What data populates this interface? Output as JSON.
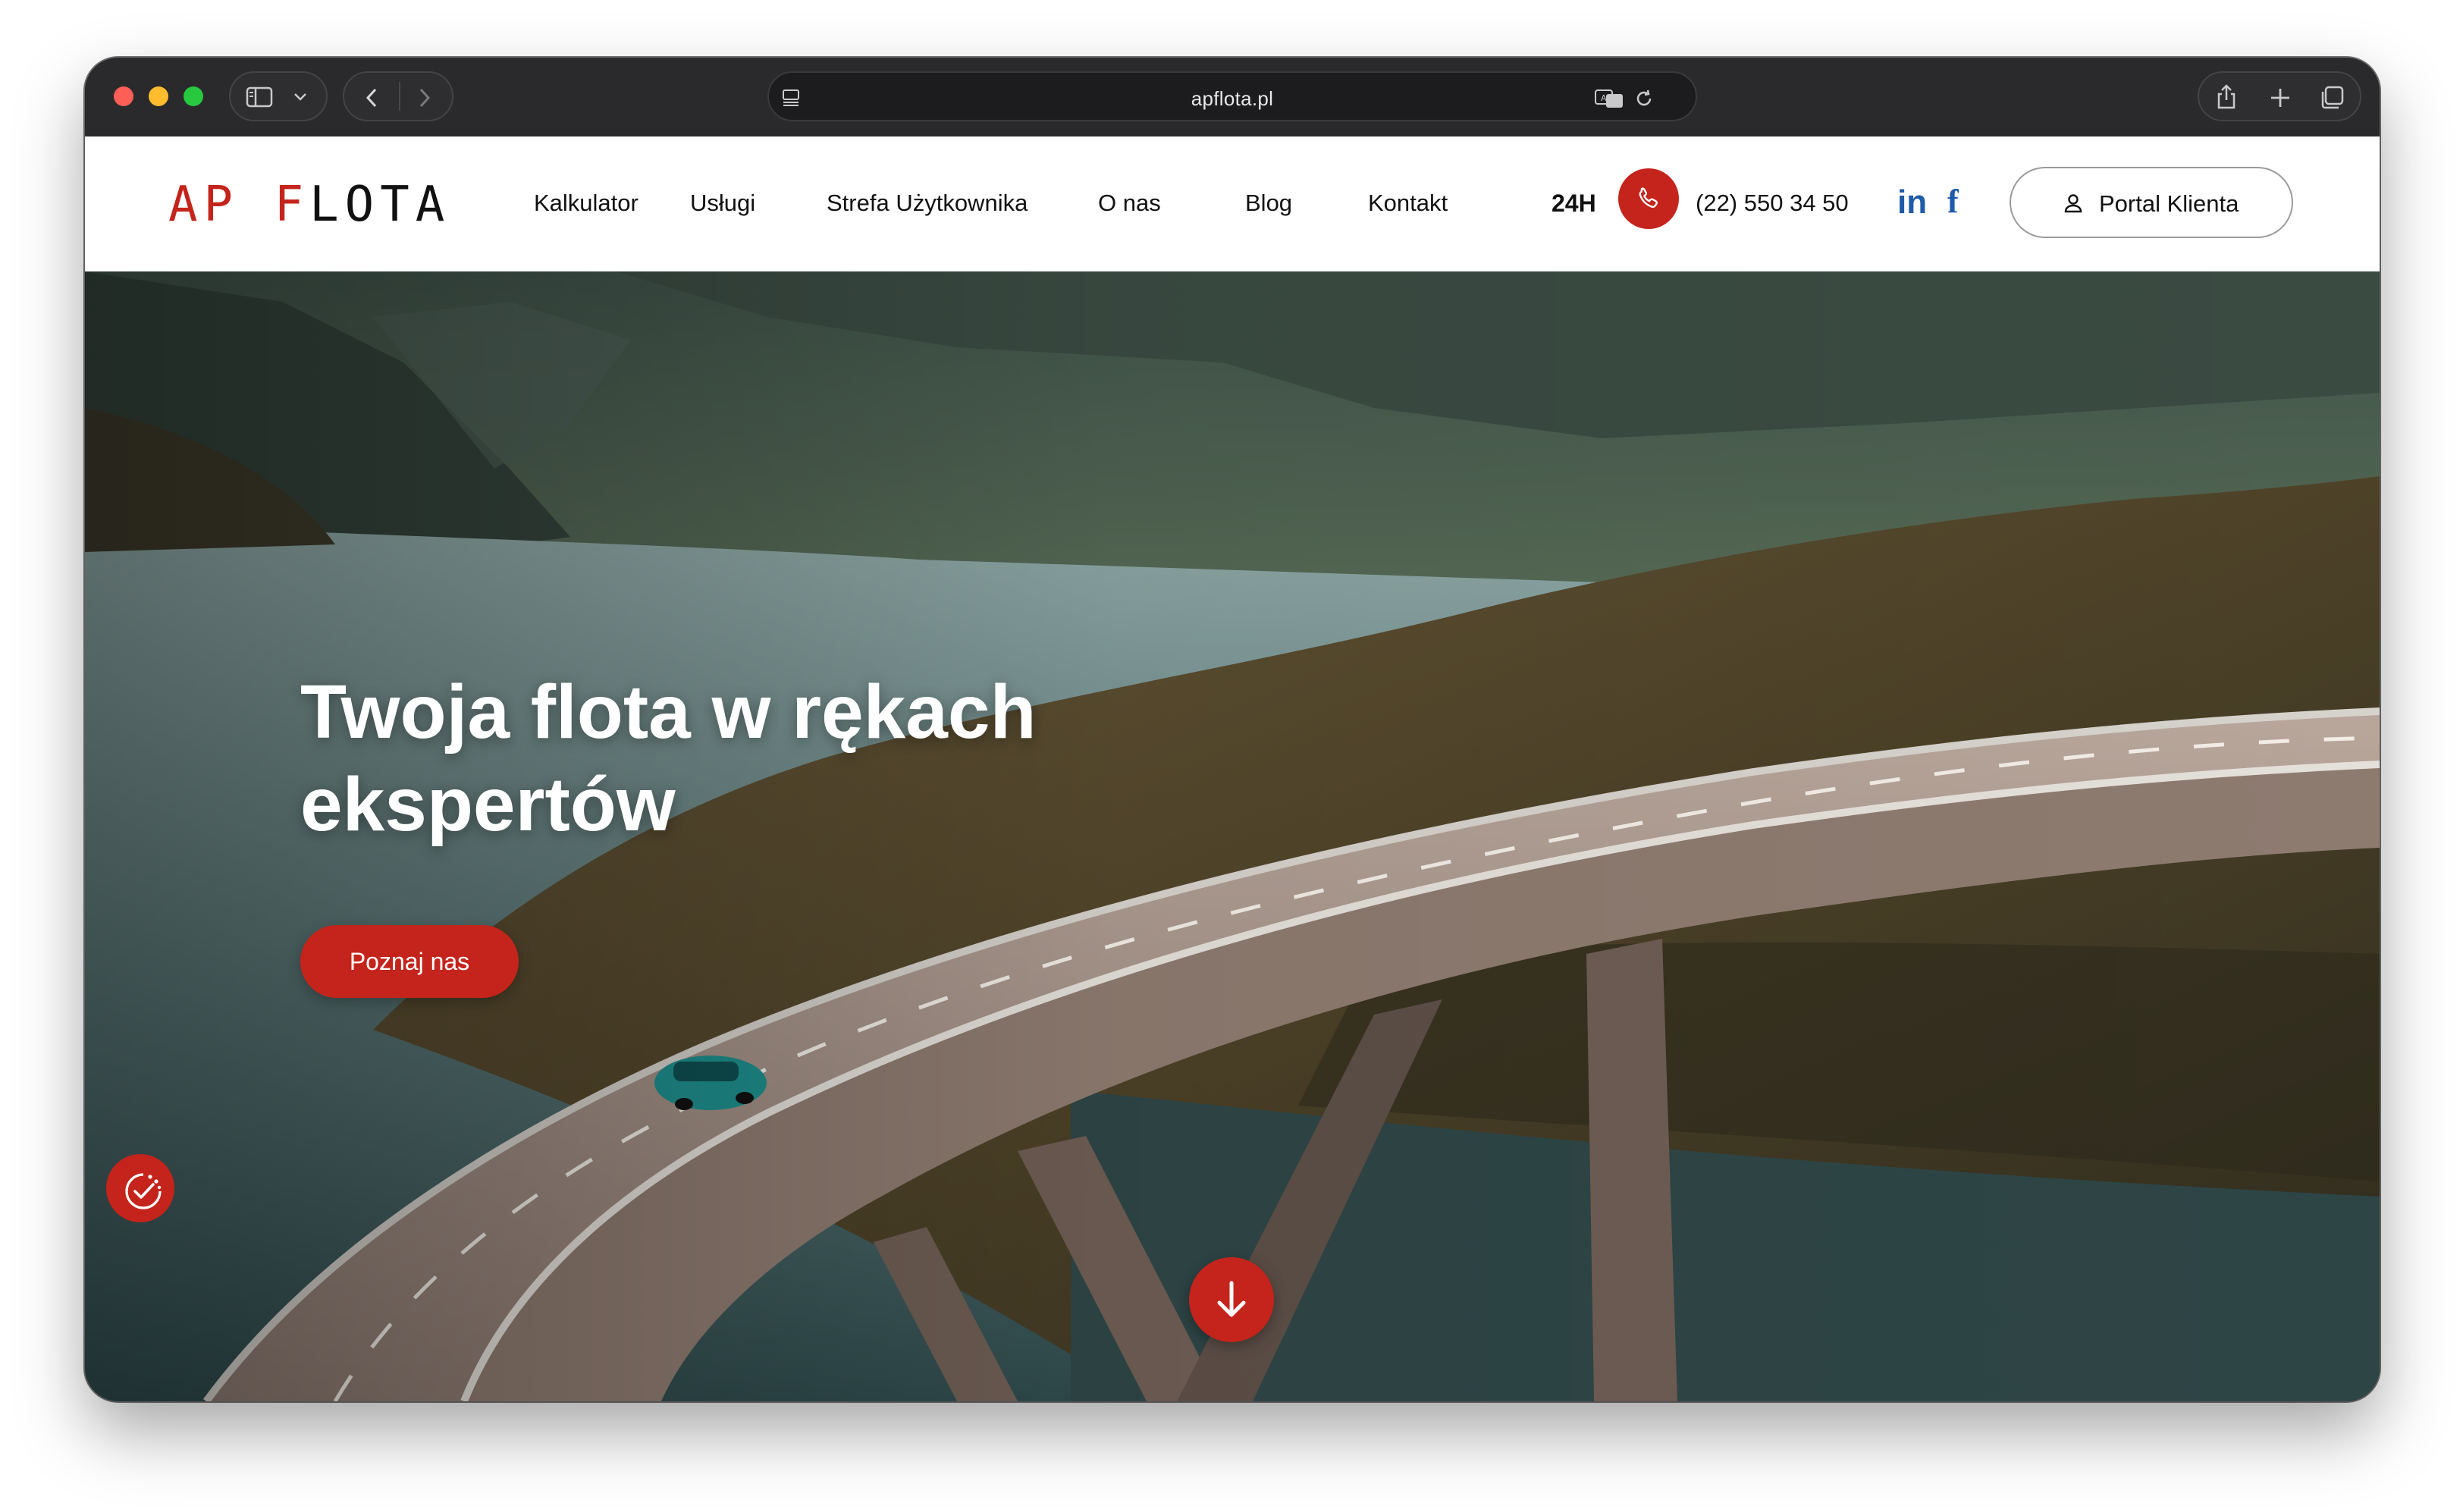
{
  "browser": {
    "url": "apflota.pl",
    "icons": [
      "sidebar-icon",
      "chevron-down-icon",
      "back-icon",
      "forward-icon",
      "page-menu-icon",
      "translate-icon",
      "reload-icon",
      "share-icon",
      "new-tab-icon",
      "tabs-overview-icon"
    ]
  },
  "header": {
    "logo": {
      "part1": "AP",
      "part2": "F",
      "part3": "LOTA"
    },
    "nav": [
      "Kalkulator",
      "Usługi",
      "Strefa Użytkownika",
      "O nas",
      "Blog",
      "Kontakt"
    ],
    "availability": "24H",
    "phone": "(22) 550 34 50",
    "social": {
      "linkedin": "in",
      "facebook": "f"
    },
    "portal_label": "Portal Klienta"
  },
  "hero": {
    "title_line1": "Twoja flota w rękach",
    "title_line2": "ekspertów",
    "cta_label": "Poznaj nas"
  },
  "colors": {
    "accent": "#c4241b",
    "social": "#1e5ba8",
    "text": "#111111"
  }
}
